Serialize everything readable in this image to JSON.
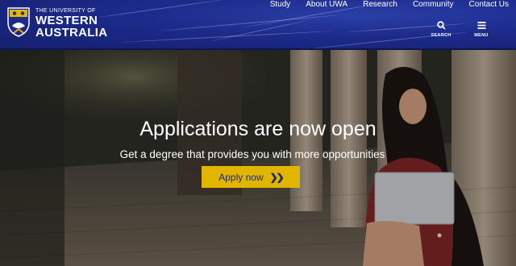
{
  "header": {
    "logo": {
      "line1": "THE UNIVERSITY OF",
      "line2": "WESTERN",
      "line3": "AUSTRALIA"
    },
    "nav": [
      "Study",
      "About UWA",
      "Research",
      "Community",
      "Contact Us"
    ],
    "tools": {
      "search_label": "SEARCH",
      "menu_label": "MENU"
    },
    "colors": {
      "bar": "#1c2a8a",
      "accent": "#e2b600"
    }
  },
  "hero": {
    "title": "Applications are now open",
    "subtitle": "Get a degree that provides you with more opportunities",
    "cta_label": "Apply now",
    "cta_icon": "double-chevron-right-icon"
  }
}
